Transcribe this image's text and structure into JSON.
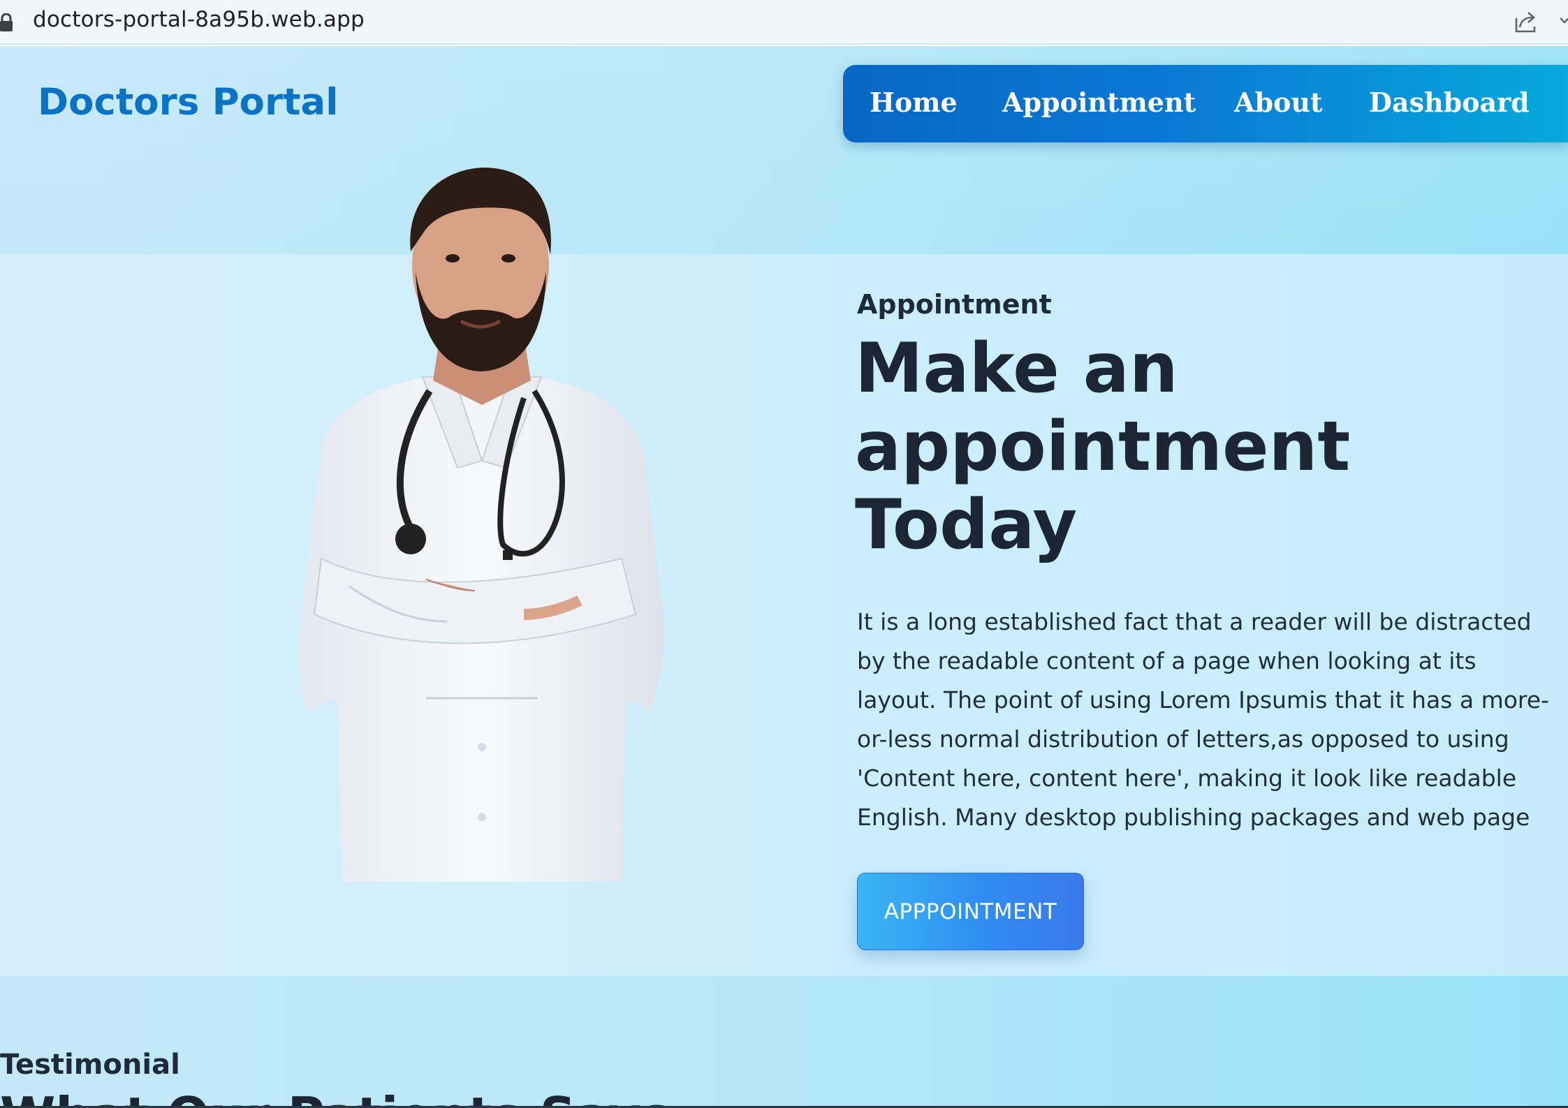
{
  "browser": {
    "url": "doctors-portal-8a95b.web.app",
    "icons": [
      "lock-icon",
      "share-icon",
      "chevron-down-icon"
    ]
  },
  "header": {
    "brand": "Doctors Portal",
    "brand_color": "#0a73c4",
    "nav": {
      "home": "Home",
      "appointment": "Appointment",
      "about": "About",
      "dashboard": "Dashboard"
    },
    "nav_colors": [
      "#0867c4",
      "#05a9dc"
    ]
  },
  "hero": {
    "eyebrow": "Appointment",
    "headline_line1": "Make an",
    "headline_line2": "appointment",
    "headline_line3": "Today",
    "description": "It is a long established fact that a reader will be distracted by the readable content of a page when looking at its layout. The point of using Lorem Ipsumis that it has a more-or-less normal distribution of letters,as opposed to using 'Content here, content here', making it look like readable English. Many desktop publishing packages and web page",
    "button_label": "APPPOINTMENT",
    "button_colors": [
      "#39b6f5",
      "#3a78ec"
    ]
  },
  "testimonial": {
    "label": "Testimonial",
    "title": "What Our Patients Says"
  }
}
